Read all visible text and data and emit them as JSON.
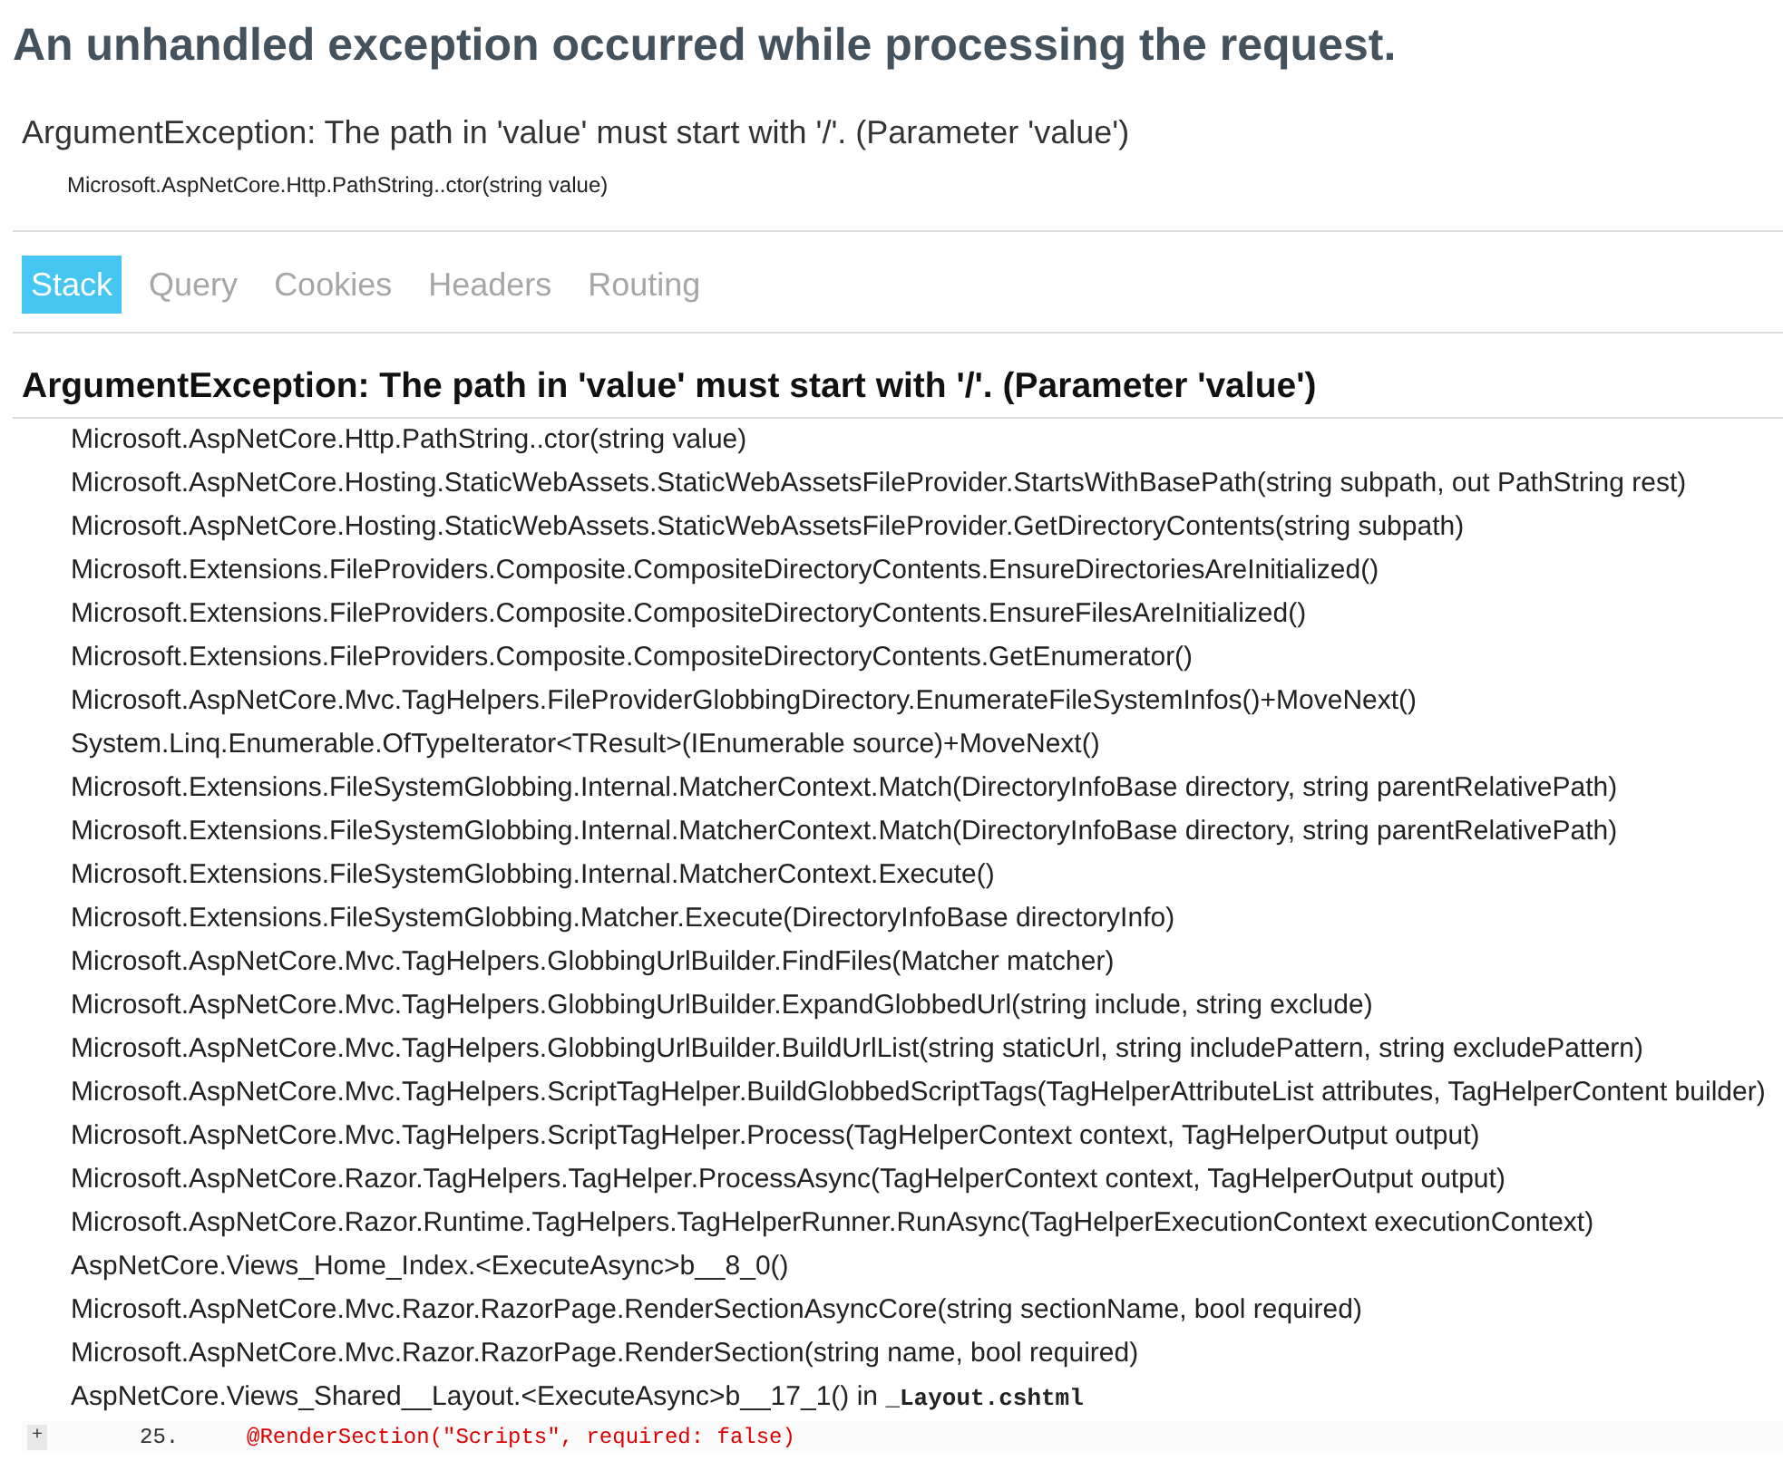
{
  "page": {
    "title": "An unhandled exception occurred while processing the request."
  },
  "exception": {
    "message": "ArgumentException: The path in 'value' must start with '/'. (Parameter 'value')",
    "location": "Microsoft.AspNetCore.Http.PathString..ctor(string value)"
  },
  "tabs": [
    {
      "label": "Stack",
      "selected": true
    },
    {
      "label": "Query",
      "selected": false
    },
    {
      "label": "Cookies",
      "selected": false
    },
    {
      "label": "Headers",
      "selected": false
    },
    {
      "label": "Routing",
      "selected": false
    }
  ],
  "stack": {
    "heading": "ArgumentException: The path in 'value' must start with '/'. (Parameter 'value')",
    "frames": [
      {
        "method": "Microsoft.AspNetCore.Http.PathString..ctor(string value)"
      },
      {
        "method": "Microsoft.AspNetCore.Hosting.StaticWebAssets.StaticWebAssetsFileProvider.StartsWithBasePath(string subpath, out PathString rest)"
      },
      {
        "method": "Microsoft.AspNetCore.Hosting.StaticWebAssets.StaticWebAssetsFileProvider.GetDirectoryContents(string subpath)"
      },
      {
        "method": "Microsoft.Extensions.FileProviders.Composite.CompositeDirectoryContents.EnsureDirectoriesAreInitialized()"
      },
      {
        "method": "Microsoft.Extensions.FileProviders.Composite.CompositeDirectoryContents.EnsureFilesAreInitialized()"
      },
      {
        "method": "Microsoft.Extensions.FileProviders.Composite.CompositeDirectoryContents.GetEnumerator()"
      },
      {
        "method": "Microsoft.AspNetCore.Mvc.TagHelpers.FileProviderGlobbingDirectory.EnumerateFileSystemInfos()+MoveNext()"
      },
      {
        "method": "System.Linq.Enumerable.OfTypeIterator<TResult>(IEnumerable source)+MoveNext()"
      },
      {
        "method": "Microsoft.Extensions.FileSystemGlobbing.Internal.MatcherContext.Match(DirectoryInfoBase directory, string parentRelativePath)"
      },
      {
        "method": "Microsoft.Extensions.FileSystemGlobbing.Internal.MatcherContext.Match(DirectoryInfoBase directory, string parentRelativePath)"
      },
      {
        "method": "Microsoft.Extensions.FileSystemGlobbing.Internal.MatcherContext.Execute()"
      },
      {
        "method": "Microsoft.Extensions.FileSystemGlobbing.Matcher.Execute(DirectoryInfoBase directoryInfo)"
      },
      {
        "method": "Microsoft.AspNetCore.Mvc.TagHelpers.GlobbingUrlBuilder.FindFiles(Matcher matcher)"
      },
      {
        "method": "Microsoft.AspNetCore.Mvc.TagHelpers.GlobbingUrlBuilder.ExpandGlobbedUrl(string include, string exclude)"
      },
      {
        "method": "Microsoft.AspNetCore.Mvc.TagHelpers.GlobbingUrlBuilder.BuildUrlList(string staticUrl, string includePattern, string excludePattern)"
      },
      {
        "method": "Microsoft.AspNetCore.Mvc.TagHelpers.ScriptTagHelper.BuildGlobbedScriptTags(TagHelperAttributeList attributes, TagHelperContent builder)"
      },
      {
        "method": "Microsoft.AspNetCore.Mvc.TagHelpers.ScriptTagHelper.Process(TagHelperContext context, TagHelperOutput output)"
      },
      {
        "method": "Microsoft.AspNetCore.Razor.TagHelpers.TagHelper.ProcessAsync(TagHelperContext context, TagHelperOutput output)"
      },
      {
        "method": "Microsoft.AspNetCore.Razor.Runtime.TagHelpers.TagHelperRunner.RunAsync(TagHelperExecutionContext executionContext)"
      },
      {
        "method": "AspNetCore.Views_Home_Index.<ExecuteAsync>b__8_0()"
      },
      {
        "method": "Microsoft.AspNetCore.Mvc.Razor.RazorPage.RenderSectionAsyncCore(string sectionName, bool required)"
      },
      {
        "method": "Microsoft.AspNetCore.Mvc.Razor.RazorPage.RenderSection(string name, bool required)"
      },
      {
        "method": "AspNetCore.Views_Shared__Layout.<ExecuteAsync>b__17_1()",
        "file_prefix": "in",
        "file": "_Layout.cshtml",
        "source": {
          "toggle": "+",
          "lines": [
            {
              "number": "25.",
              "code": "@RenderSection(\"Scripts\", required: false)",
              "kind": "error"
            }
          ]
        }
      }
    ]
  }
}
